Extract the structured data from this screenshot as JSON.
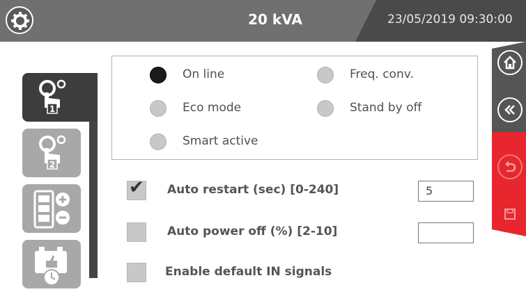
{
  "header": {
    "title": "20 kVA",
    "datetime": "23/05/2019 09:30:00",
    "menu_icon": "gear-icon"
  },
  "sidebar": {
    "items": [
      {
        "icon": "touch-gear-1-icon",
        "active": true
      },
      {
        "icon": "touch-gear-2-icon",
        "active": false
      },
      {
        "icon": "battery-plus-minus-icon",
        "active": false
      },
      {
        "icon": "battery-clock-icon",
        "active": false
      }
    ]
  },
  "modes": {
    "options": [
      {
        "label": "On line",
        "selected": true
      },
      {
        "label": "Freq. conv.",
        "selected": false
      },
      {
        "label": "Eco mode",
        "selected": false
      },
      {
        "label": "Stand by off",
        "selected": false
      },
      {
        "label": "Smart active",
        "selected": false
      }
    ]
  },
  "settings": {
    "auto_restart": {
      "label": "Auto restart (sec) [0-240]",
      "checked": true,
      "value": "5"
    },
    "auto_power_off": {
      "label": "Auto power off (%) [2-10]",
      "checked": false,
      "value": ""
    },
    "default_in_signals": {
      "label": "Enable default IN signals",
      "checked": false
    }
  },
  "right_panel": {
    "buttons": [
      "home-icon",
      "back-skip-icon",
      "undo-icon",
      "save-icon"
    ]
  },
  "colors": {
    "header_bg": "#707070",
    "accent_red": "#e8262e",
    "dark_panel": "#3d3d3d"
  }
}
